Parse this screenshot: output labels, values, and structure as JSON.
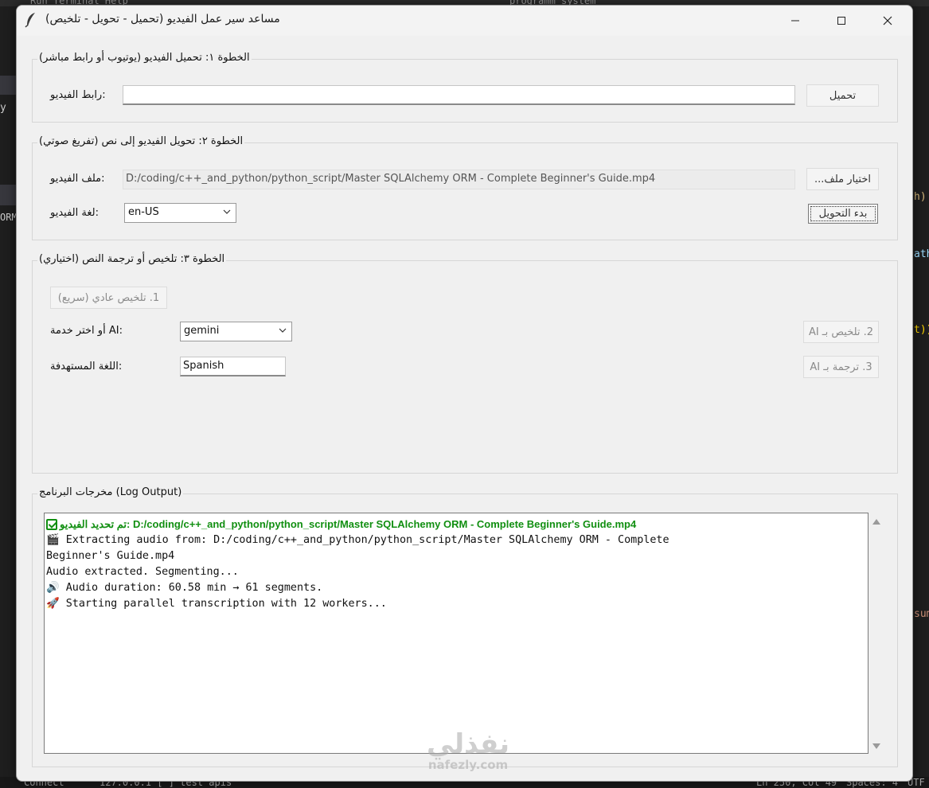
{
  "window": {
    "title": "مساعد سير عمل الفيديو (تحميل - تحويل - تلخيص)"
  },
  "step1": {
    "title": "الخطوة ١: تحميل الفيديو (يوتيوب أو رابط مباشر)",
    "url_label": ":رابط الفيديو",
    "url_value": "",
    "download_button": "تحميل"
  },
  "step2": {
    "title": "الخطوة ٢: تحويل الفيديو إلى نص (تفريغ صوتي)",
    "file_label": ":ملف الفيديو",
    "file_value": "D:/coding/c++_and_python/python_script/Master SQLAlchemy ORM - Complete Beginner's Guide.mp4",
    "choose_file_button": "...اختيار ملف",
    "language_label": ":لغة الفيديو",
    "language_value": "en-US",
    "start_button": "بدء التحويل"
  },
  "step3": {
    "title": "الخطوة ٣: تلخيص أو ترجمة النص (اختياري)",
    "normal_summary_button": "1. تلخيص عادي (سريع)",
    "ai_service_label": ":AI أو اختر خدمة",
    "ai_service_value": "gemini",
    "ai_summary_button": "2. تلخيص بـ AI",
    "target_lang_label": ":اللغة المستهدفة",
    "target_lang_value": "Spanish",
    "ai_translate_button": "3. ترجمة بـ AI"
  },
  "log": {
    "title": "مخرجات البرنامج (Log Output)",
    "lines": [
      "تم تحديد الفيديو: D:/coding/c++_and_python/python_script/Master SQLAlchemy ORM - Complete Beginner's Guide.mp4",
      "🎬 Extracting audio from: D:/coding/c++_and_python/python_script/Master SQLAlchemy ORM - Complete",
      "Beginner's Guide.mp4",
      "Audio extracted. Segmenting...",
      "🔊 Audio duration: 60.58 min → 61 segments.",
      "🚀 Starting parallel transcription with 12 workers..."
    ]
  },
  "watermark": {
    "arabic": "نفذلي",
    "latin": "nafezly.com"
  },
  "background_editor": {
    "menu": "Run  Terminal  Help",
    "search": "programm_system",
    "status_left": "Connect",
    "status_ip": "127.0.0.1 [ ] test apis",
    "status_pos": "Ln 250, Col 49",
    "status_spaces": "Spaces: 4",
    "status_enc": "UTF"
  },
  "colors": {
    "log_green": "#118f11",
    "window_bg": "#f0f0f0"
  }
}
